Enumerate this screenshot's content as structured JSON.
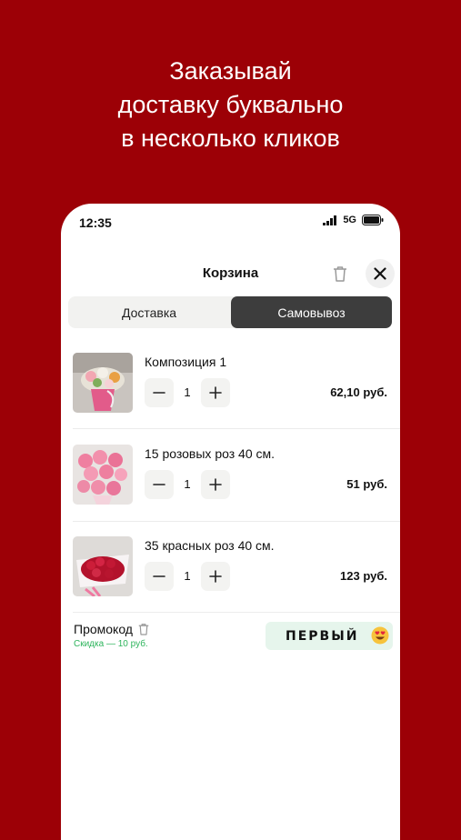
{
  "headline": {
    "line1": "Заказывай",
    "line2": "доставку буквально",
    "line3": "в несколько кликов"
  },
  "status_bar": {
    "time": "12:35",
    "network": "5G"
  },
  "header": {
    "title": "Корзина",
    "icons": [
      "trash-icon",
      "close-icon"
    ]
  },
  "tabs": [
    {
      "label": "Доставка",
      "active": false
    },
    {
      "label": "Самовывоз",
      "active": true
    }
  ],
  "cart_items": [
    {
      "name": "Композиция 1",
      "quantity": "1",
      "price": "62,10 руб."
    },
    {
      "name": "15 розовых роз 40 см.",
      "quantity": "1",
      "price": "51 руб."
    },
    {
      "name": "35 красных роз 40 см.",
      "quantity": "1",
      "price": "123 руб."
    }
  ],
  "promo": {
    "label": "Промокод",
    "discount": "Скидка — 10 руб.",
    "code": "ПЕРВЫЙ"
  },
  "colors": {
    "background": "#9c0006",
    "active_tab": "#3d3d3d",
    "promo_bg": "#e6f5ec",
    "discount_text": "#2db45c"
  }
}
